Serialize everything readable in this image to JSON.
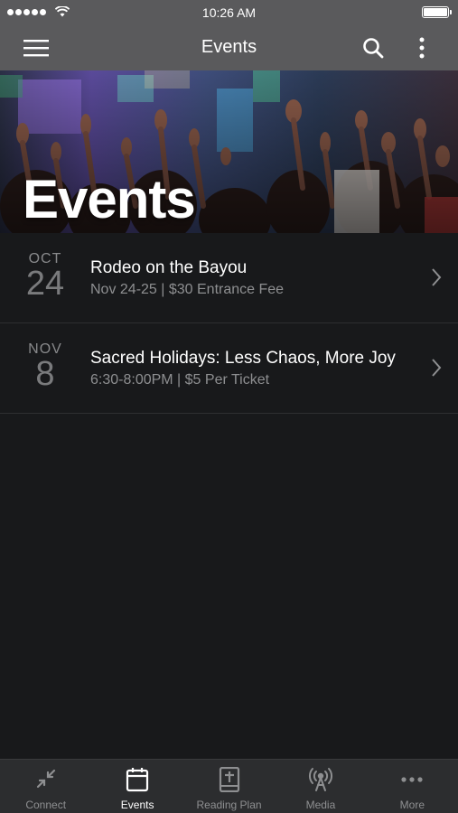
{
  "status_bar": {
    "time": "10:26 AM"
  },
  "nav": {
    "title": "Events"
  },
  "hero": {
    "title": "Events"
  },
  "events": [
    {
      "month": "OCT",
      "day": "24",
      "title": "Rodeo on the Bayou",
      "subtitle": "Nov 24-25 | $30 Entrance Fee"
    },
    {
      "month": "NOV",
      "day": "8",
      "title": "Sacred Holidays: Less Chaos, More Joy",
      "subtitle": "6:30-8:00PM | $5 Per Ticket"
    }
  ],
  "tabs": [
    {
      "label": "Connect",
      "icon": "connect-icon"
    },
    {
      "label": "Events",
      "icon": "calendar-icon",
      "active": true
    },
    {
      "label": "Reading Plan",
      "icon": "bible-icon"
    },
    {
      "label": "Media",
      "icon": "broadcast-icon"
    },
    {
      "label": "More",
      "icon": "more-dots-icon"
    }
  ]
}
